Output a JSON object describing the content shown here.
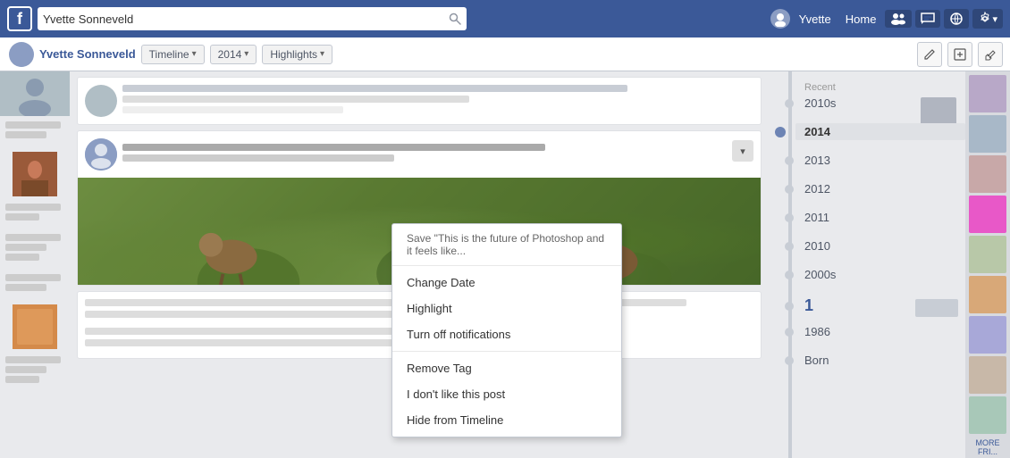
{
  "nav": {
    "logo": "f",
    "search_placeholder": "Yvette Sonneveld",
    "username": "Yvette",
    "home_label": "Home",
    "friends_icon": "👥",
    "messenger_icon": "💬",
    "globe_icon": "🌐",
    "settings_icon": "⚙"
  },
  "profile_bar": {
    "name": "Yvette Sonneveld",
    "timeline_label": "Timeline",
    "year_label": "2014",
    "highlights_label": "Highlights",
    "edit_icon": "✏",
    "update_icon": "⊞",
    "settings_icon": "⚑"
  },
  "dropdown": {
    "save_item": "Save \"This is the future of Photoshop and it feels like...",
    "change_date": "Change Date",
    "highlight": "Highlight",
    "turn_off_notifications": "Turn off notifications",
    "remove_tag": "Remove Tag",
    "dont_like": "I don't like this post",
    "hide_from_timeline": "Hide from Timeline"
  },
  "timeline": {
    "recent_label": "Recent",
    "years": [
      "2010s",
      "2014",
      "2013",
      "2012",
      "2011",
      "2010",
      "2000s",
      "1",
      "1986",
      "Born"
    ],
    "active_year": "2014"
  },
  "far_right": {
    "more_friends_label": "MORE FRI..."
  }
}
